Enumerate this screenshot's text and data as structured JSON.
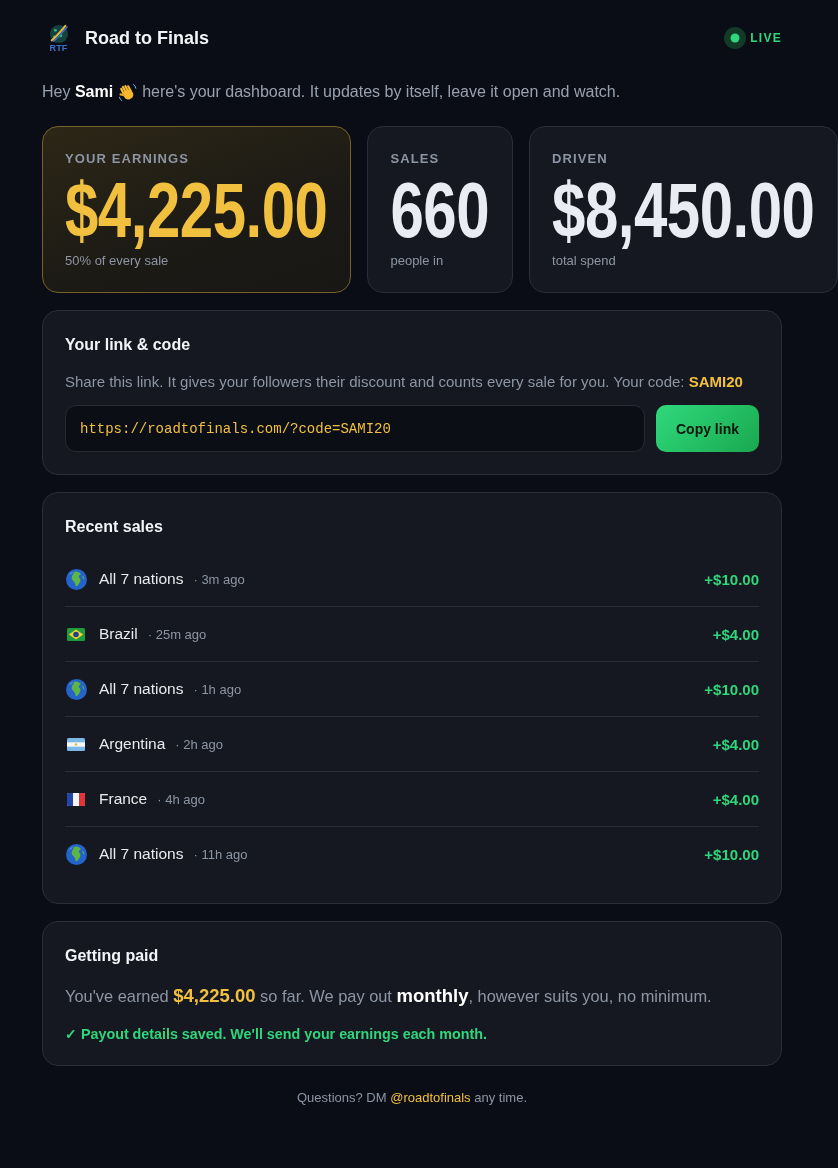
{
  "header": {
    "logo_text": "RTF",
    "brand": "Road to Finals",
    "live": {
      "label": "LIVE",
      "on": true
    }
  },
  "greeting": {
    "before": "Hey **Sami**",
    "after": "here's your dashboard. It updates by itself, leave it open and watch."
  },
  "stats": [
    {
      "kind": "highlight",
      "label": "YOUR EARNINGS",
      "value": "$4,225.00",
      "caption": "50% of every sale"
    },
    {
      "kind": "plain",
      "label": "SALES",
      "value": "660",
      "caption": "people in"
    },
    {
      "kind": "plain",
      "label": "DRIVEN",
      "value": "$8,450.00",
      "caption": "total spend"
    }
  ],
  "link_card": {
    "title": "Your link & code",
    "description": "Share this link. It gives your followers their discount and counts every sale for you. Your code: **SAMI20**",
    "link_field": {
      "value": "https://roadtofinals.com/?code=SAMI20"
    },
    "copy_button": "Copy link"
  },
  "recent_sales": {
    "title": "Recent sales",
    "rows": [
      {
        "kind": "globe",
        "item": "All 7 nations",
        "time": "· 3m ago",
        "amount": "+$10.00"
      },
      {
        "kind": "brazil",
        "item": "Brazil",
        "time": "· 25m ago",
        "amount": "+$4.00"
      },
      {
        "kind": "globe",
        "item": "All 7 nations",
        "time": "· 1h ago",
        "amount": "+$10.00"
      },
      {
        "kind": "argentina",
        "item": "Argentina",
        "time": "· 2h ago",
        "amount": "+$4.00"
      },
      {
        "kind": "france",
        "item": "France",
        "time": "· 4h ago",
        "amount": "+$4.00"
      },
      {
        "kind": "globe",
        "item": "All 7 nations",
        "time": "· 11h ago",
        "amount": "+$10.00"
      }
    ]
  },
  "payout_card": {
    "title": "Getting paid",
    "text": "You've earned **$4,225.00** so far. We pay out **monthly**, however suits you, no minimum.",
    "notice": "✓ Payout details saved. We'll send your earnings each month."
  },
  "footer": {
    "before": "Questions? DM",
    "link": "@roadtofinals",
    "after": "any time."
  }
}
